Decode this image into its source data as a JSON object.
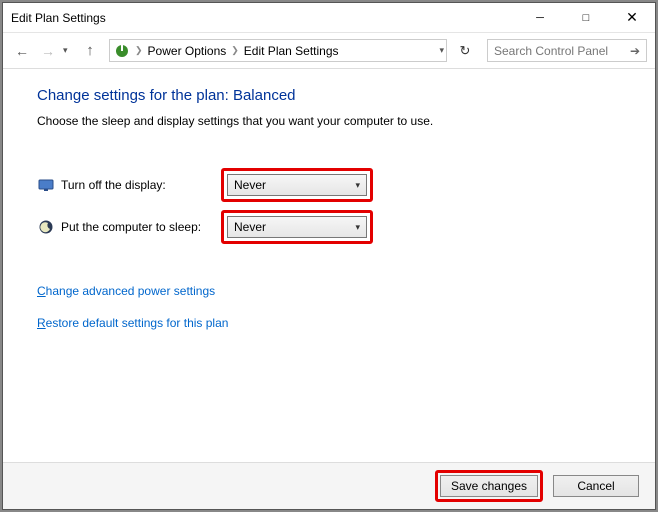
{
  "window": {
    "title": "Edit Plan Settings"
  },
  "breadcrumb": {
    "level1": "Power Options",
    "level2": "Edit Plan Settings"
  },
  "search": {
    "placeholder": "Search Control Panel"
  },
  "page": {
    "heading": "Change settings for the plan: Balanced",
    "sub": "Choose the sleep and display settings that you want your computer to use."
  },
  "settings": {
    "display_label": "Turn off the display:",
    "display_value": "Never",
    "sleep_label": "Put the computer to sleep:",
    "sleep_value": "Never"
  },
  "links": {
    "advanced_prefix": "C",
    "advanced_rest": "hange advanced power settings",
    "restore_prefix": "R",
    "restore_rest": "estore default settings for this plan"
  },
  "buttons": {
    "save": "Save changes",
    "cancel": "Cancel"
  }
}
